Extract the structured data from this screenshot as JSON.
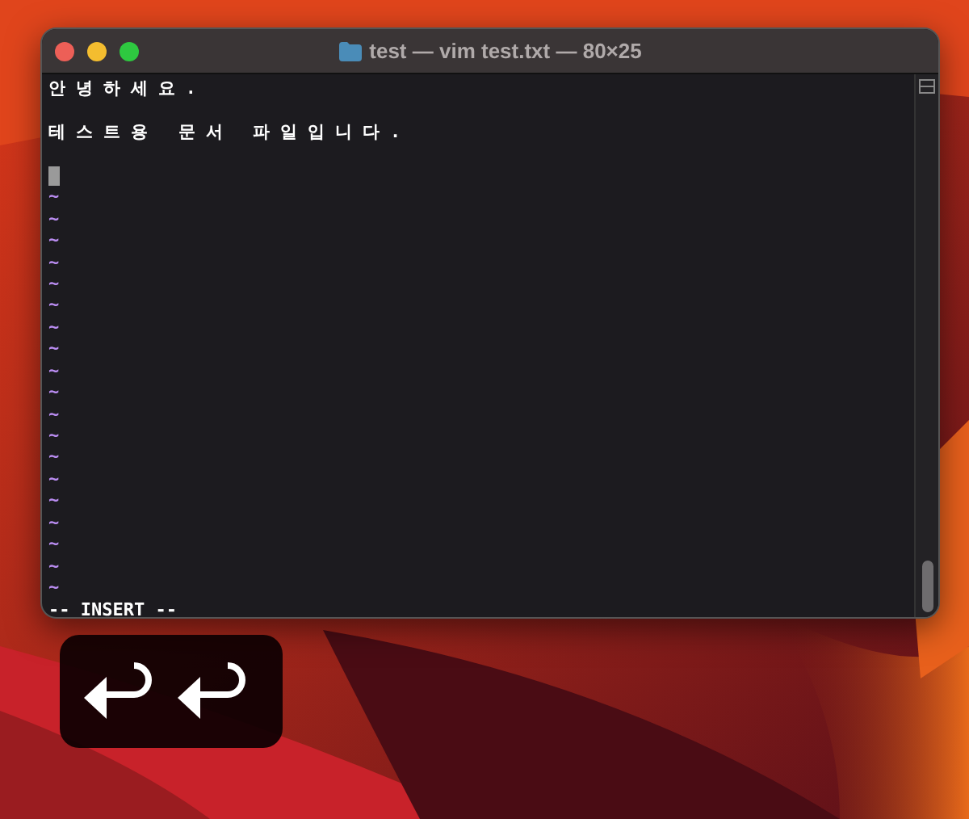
{
  "window": {
    "title": "test — vim test.txt — 80×25"
  },
  "lines": [
    {
      "kind": "text",
      "text": "안녕하세요."
    },
    {
      "kind": "blank"
    },
    {
      "kind": "text",
      "text": "테스트용 문서 파일입니다."
    },
    {
      "kind": "blank"
    },
    {
      "kind": "cursor"
    },
    {
      "kind": "tilde",
      "text": "~"
    },
    {
      "kind": "tilde",
      "text": "~"
    },
    {
      "kind": "tilde",
      "text": "~"
    },
    {
      "kind": "tilde",
      "text": "~"
    },
    {
      "kind": "tilde",
      "text": "~"
    },
    {
      "kind": "tilde",
      "text": "~"
    },
    {
      "kind": "tilde",
      "text": "~"
    },
    {
      "kind": "tilde",
      "text": "~"
    },
    {
      "kind": "tilde",
      "text": "~"
    },
    {
      "kind": "tilde",
      "text": "~"
    },
    {
      "kind": "tilde",
      "text": "~"
    },
    {
      "kind": "tilde",
      "text": "~"
    },
    {
      "kind": "tilde",
      "text": "~"
    },
    {
      "kind": "tilde",
      "text": "~"
    },
    {
      "kind": "tilde",
      "text": "~"
    },
    {
      "kind": "tilde",
      "text": "~"
    },
    {
      "kind": "tilde",
      "text": "~"
    },
    {
      "kind": "tilde",
      "text": "~"
    },
    {
      "kind": "tilde",
      "text": "~"
    }
  ],
  "status_line": "-- INSERT --",
  "keycast": {
    "keys": [
      {
        "kind": "return"
      },
      {
        "kind": "return"
      }
    ]
  }
}
